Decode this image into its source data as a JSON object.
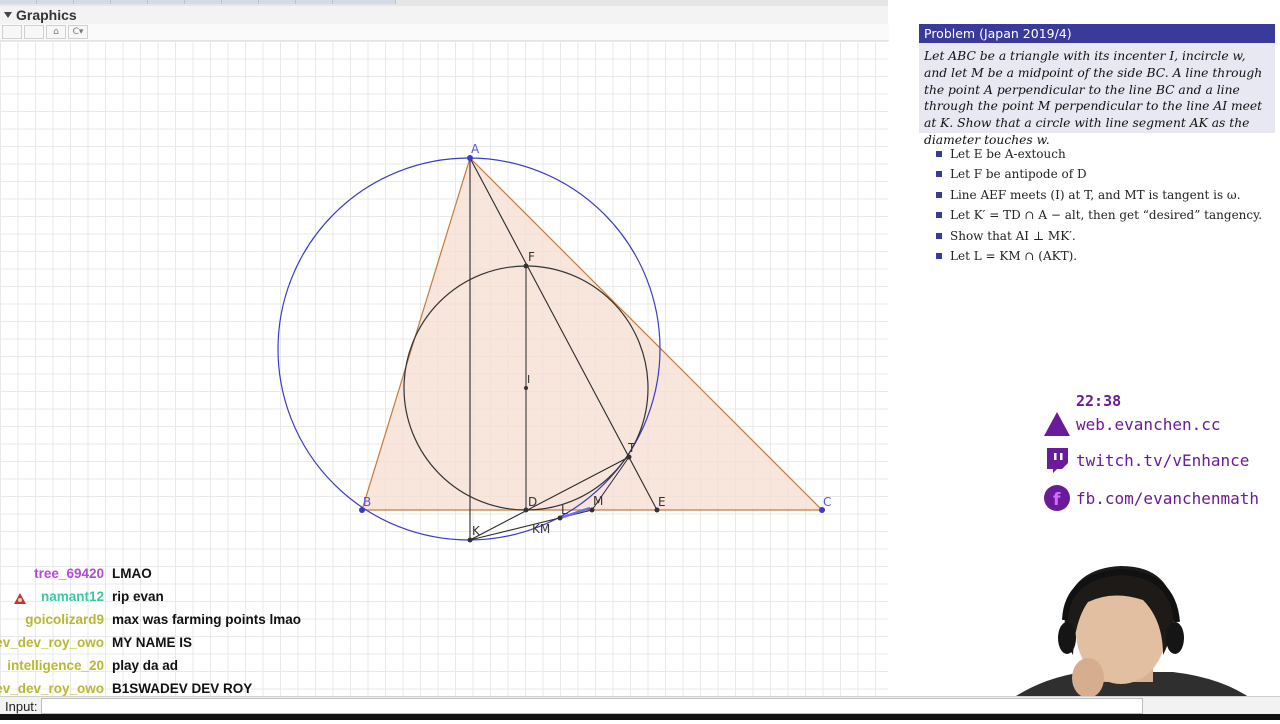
{
  "app": {
    "panel_title": "Graphics",
    "toolbar": {
      "home_icon": "⌂",
      "style_label": "C▾"
    },
    "input_label": "Input:"
  },
  "figure": {
    "points": {
      "A": "A",
      "B": "B",
      "C": "C",
      "D": "D",
      "E": "E",
      "F": "F",
      "I": "I",
      "T": "T",
      "K": "K",
      "L": "L",
      "M": "M",
      "KM": "KM"
    },
    "colors": {
      "triangle_stroke": "#c77a3a",
      "triangle_fill": "#f6dcd0",
      "circumcircle": "#3b3bc8",
      "incircle": "#333333",
      "segments": "#2a2a2a",
      "label_blue": "#5656d6"
    }
  },
  "problem": {
    "title": "Problem (Japan 2019/4)",
    "body": "Let ABC be a triangle with its incenter I, incircle w, and let M be a midpoint of the side BC. A line through the point A perpendicular to the line BC and a line through the point M perpendicular to the line AI meet at K. Show that a circle with line segment AK as the diameter touches w.",
    "steps": [
      "Let E be A-extouch",
      "Let F be antipode of D",
      "Line AEF meets (I) at T, and MT is tangent is ω.",
      "Let K′ = TD ∩ A − alt, then get “desired” tangency.",
      "Show that AI ⊥ MK′.",
      "Let L = KM ∩ (AKT)."
    ]
  },
  "overlay": {
    "clock": "22:38",
    "links": [
      {
        "icon": "triangle-logo-icon",
        "text": "web.evanchen.cc"
      },
      {
        "icon": "twitch-icon",
        "text": "twitch.tv/vEnhance"
      },
      {
        "icon": "facebook-icon",
        "text": "fb.com/evanchenmath"
      }
    ],
    "accent_color": "#6a1b9a"
  },
  "chat": [
    {
      "user": "tree_69420",
      "color": "#b44ad8",
      "message": "LMAO",
      "badge": false
    },
    {
      "user": "namant12",
      "color": "#39c9a0",
      "message": "rip evan",
      "badge": true
    },
    {
      "user": "goicolizard9",
      "color": "#b8b833",
      "message": "max was farming points lmao",
      "badge": false
    },
    {
      "user": "swadev_dev_roy_owo",
      "color": "#b8b833",
      "message": "MY NAME IS",
      "badge": false
    },
    {
      "user": "intelligence_20",
      "color": "#b8b833",
      "message": "play da ad",
      "badge": false
    },
    {
      "user": "swadev_dev_roy_owo",
      "color": "#b8b833",
      "message": "B1SWADEV DEV ROY",
      "badge": false
    }
  ]
}
